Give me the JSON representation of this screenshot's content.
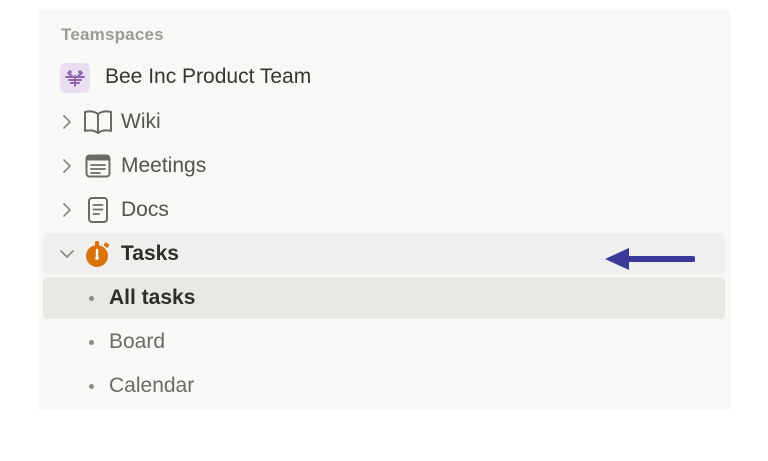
{
  "sidebar": {
    "section_title": "Teamspaces",
    "team": {
      "name": "Bee Inc Product Team",
      "icon": "bee-icon"
    },
    "items": [
      {
        "label": "Wiki",
        "icon": "book-icon",
        "expanded": false
      },
      {
        "label": "Meetings",
        "icon": "calendar-list-icon",
        "expanded": false
      },
      {
        "label": "Docs",
        "icon": "document-icon",
        "expanded": false
      },
      {
        "label": "Tasks",
        "icon": "stopwatch-icon",
        "expanded": true
      }
    ],
    "subitems": [
      {
        "label": "All tasks",
        "selected": true
      },
      {
        "label": "Board",
        "selected": false
      },
      {
        "label": "Calendar",
        "selected": false
      }
    ]
  },
  "annotation": {
    "icon": "arrow-left-icon",
    "color": "#3b3a9a"
  },
  "colors": {
    "sidebar_bg": "#f8f8f6",
    "hover_bg": "#efefed",
    "selected_bg": "#e8e8e5",
    "tasks_icon": "#d9730d",
    "team_icon": "#9065b0"
  }
}
